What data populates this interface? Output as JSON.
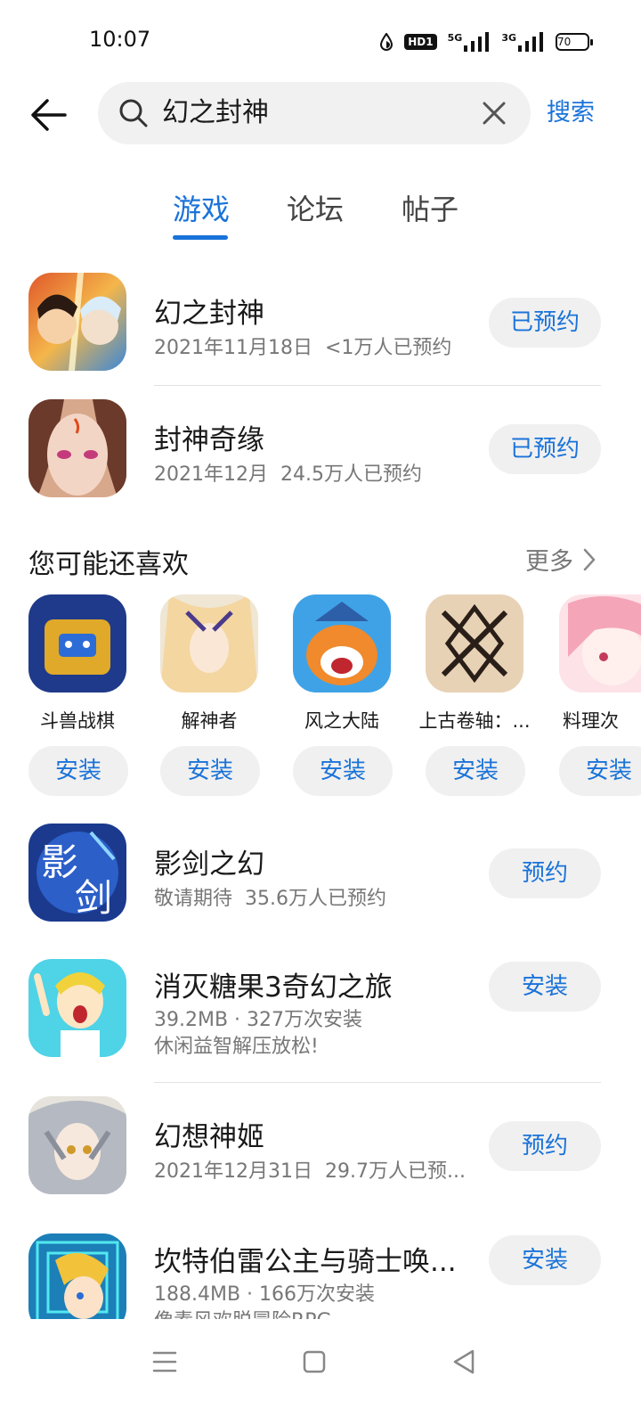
{
  "status_bar": {
    "time": "10:07",
    "hd_label": "HD1",
    "network_1": "5G",
    "network_2": "3G",
    "battery": "70"
  },
  "search": {
    "query": "幻之封神",
    "search_button": "搜索",
    "icons": [
      "arrow-left-icon",
      "search-icon",
      "close-icon"
    ]
  },
  "tabs": [
    {
      "label": "游戏",
      "active": true
    },
    {
      "label": "论坛",
      "active": false
    },
    {
      "label": "帖子",
      "active": false
    }
  ],
  "results": [
    {
      "name": "幻之封神",
      "date": "2021年11月18日",
      "stat": "<1万人已预约",
      "action": "已预约"
    },
    {
      "name": "封神奇缘",
      "date": "2021年12月",
      "stat": "24.5万人已预约",
      "action": "已预约"
    }
  ],
  "recommendations": {
    "title": "您可能还喜欢",
    "more": "更多",
    "items": [
      {
        "name": "斗兽战棋",
        "action": "安装"
      },
      {
        "name": "解神者",
        "action": "安装"
      },
      {
        "name": "风之大陆",
        "action": "安装"
      },
      {
        "name": "上古卷轴：...",
        "action": "安装"
      },
      {
        "name": "料理次",
        "action": "安装"
      }
    ]
  },
  "more_results": [
    {
      "name": "影剑之幻",
      "line1": "敬请期待",
      "line1b": "35.6万人已预约",
      "line2": "",
      "action": "预约"
    },
    {
      "name": "消灭糖果3奇幻之旅",
      "line1": "39.2MB · 327万次安装",
      "line1b": "",
      "line2": "休闲益智解压放松!",
      "action": "安装"
    },
    {
      "name": "幻想神姬",
      "line1": "2021年12月31日",
      "line1b": "29.7万人已预...",
      "line2": "",
      "action": "预约"
    },
    {
      "name": "坎特伯雷公主与骑士唤...",
      "line1": "188.4MB · 166万次安装",
      "line1b": "",
      "line2": "像素风欢脱冒险RPG",
      "action": "安装"
    }
  ],
  "colors": {
    "accent": "#1a73d9",
    "button_bg": "#f0f0f0",
    "secondary_text": "#777777"
  },
  "nav": {
    "icons": [
      "menu-icon",
      "home-square-icon",
      "back-triangle-icon"
    ]
  }
}
